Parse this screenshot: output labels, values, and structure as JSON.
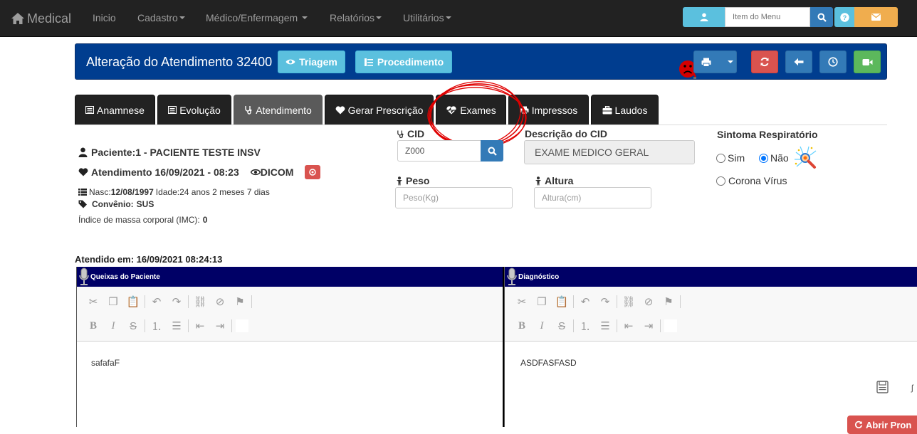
{
  "navbar": {
    "brand": "Medical",
    "items": [
      "Inicio",
      "Cadastro",
      "Médico/Enfermagem",
      "Relatórios",
      "Utilitários"
    ],
    "menu_search_placeholder": "Item do Menu"
  },
  "header": {
    "title": "Alteração do Atendimento 32400",
    "triagem": "Triagem",
    "procedimento": "Procedimento"
  },
  "tabs": [
    {
      "label": "Anamnese",
      "icon": "list-alt-icon"
    },
    {
      "label": "Evolução",
      "icon": "list-alt-icon"
    },
    {
      "label": "Atendimento",
      "icon": "stethoscope-icon",
      "active": true
    },
    {
      "label": "Gerar Prescrição",
      "icon": "heart-icon"
    },
    {
      "label": "Exames",
      "icon": "heartbeat-icon"
    },
    {
      "label": "Impressos",
      "icon": "print-icon"
    },
    {
      "label": "Laudos",
      "icon": "briefcase-icon"
    }
  ],
  "patient": {
    "name_line": "Paciente:1 - PACIENTE TESTE INSV",
    "atendimento_line": "Atendimento 16/09/2021 - 08:23",
    "dicom": "DICOM",
    "nasc_label": "Nasc:",
    "nasc_value": "12/08/1997",
    "idade": "Idade:24 anos 2 meses 7 dias",
    "convenio_label": "Convênio:",
    "convenio_value": "SUS",
    "imc_label": "Índice de massa corporal (IMC):",
    "imc_value": "0",
    "atendido_em": "Atendido em: 16/09/2021 08:24:13"
  },
  "form": {
    "cid_label": "CID",
    "cid_value": "Z000",
    "desc_cid_label": "Descrição do CID",
    "desc_cid_value": "EXAME MEDICO GERAL",
    "peso_label": "Peso",
    "peso_placeholder": "Peso(Kg)",
    "altura_label": "Altura",
    "altura_placeholder": "Altura(cm)",
    "sintoma_label": "Sintoma Respiratório",
    "sim": "Sim",
    "nao": "Não",
    "nao_selected": true,
    "corona": "Corona Vírus"
  },
  "editors": {
    "queixas_title": "Queixas do Paciente",
    "queixas_text": "safafaF",
    "diagnostico_title": "Diagnóstico",
    "diagnostico_text": "ASDFASFASD"
  },
  "floating_button": "Abrir Pron",
  "colors": {
    "navbar": "#222222",
    "header_blue": "#003d8f",
    "editor_title": "#000066",
    "info": "#5bc0de",
    "primary": "#337ab7",
    "danger": "#d9534f",
    "success": "#5cb85c",
    "warning": "#f0ad4e",
    "annotation_red": "#e00000"
  }
}
